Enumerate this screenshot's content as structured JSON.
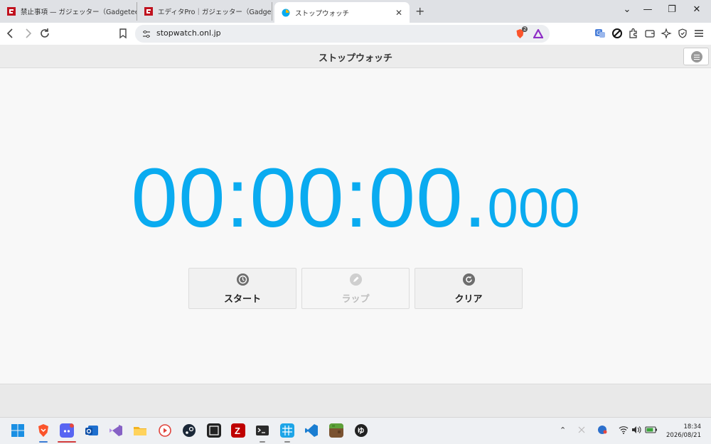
{
  "browser": {
    "tabs": [
      {
        "title": "禁止事項 — ガジェッター（Gadgeteer）",
        "active": false
      },
      {
        "title": "エディタPro｜ガジェッター（Gadgeteer）",
        "active": false
      },
      {
        "title": "ストップウォッチ",
        "active": true
      }
    ],
    "new_tab_symbol": "+",
    "close_symbol": "✕",
    "window_controls": {
      "dropdown": "⌄",
      "minimize": "—",
      "restore": "❐",
      "close": "✕"
    },
    "url": "stopwatch.onl.jp",
    "shields_badge": "2"
  },
  "page": {
    "title": "ストップウォッチ",
    "timer": {
      "hh": "00",
      "mm": "00",
      "ss": "00",
      "ms": "000",
      "sep": ":",
      "dot": "."
    },
    "buttons": {
      "start": "スタート",
      "lap": "ラップ",
      "clear": "クリア"
    }
  },
  "taskbar": {
    "time": "18:34",
    "date": "2026/08/21"
  },
  "colors": {
    "timer": "#0aabf0",
    "tab_strip": "#dfe1e5",
    "page_bg": "#f8f8f8"
  }
}
